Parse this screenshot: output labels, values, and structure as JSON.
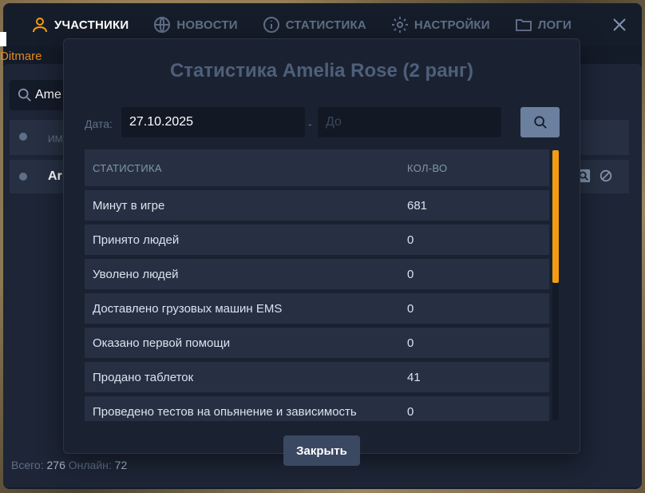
{
  "nav": {
    "tabs": [
      {
        "label": "УЧАСТНИКИ",
        "icon": "user-icon",
        "active": true
      },
      {
        "label": "НОВОСТИ",
        "icon": "globe-icon"
      },
      {
        "label": "СТАТИСТИКА",
        "icon": "info-icon"
      },
      {
        "label": "НАСТРОЙКИ",
        "icon": "gear-icon"
      },
      {
        "label": "ЛОГИ",
        "icon": "folder-icon"
      }
    ]
  },
  "background": {
    "nametag": "Ditmare"
  },
  "members": {
    "search_value": "Ame",
    "header_name": "ИМ",
    "row_name": "Ar",
    "total_label": "Всего:",
    "total_value": "276",
    "online_label": "Онлайн:",
    "online_value": "72"
  },
  "modal": {
    "title": "Статистика Amelia Rose (2 ранг)",
    "date_label": "Дата:",
    "date_from": "27.10.2025",
    "date_separator": "-",
    "date_to_placeholder": "До",
    "columns": [
      "СТАТИСТИКА",
      "КОЛ-ВО"
    ],
    "rows": [
      {
        "name": "Минут в игре",
        "value": "681"
      },
      {
        "name": "Принято людей",
        "value": "0"
      },
      {
        "name": "Уволено людей",
        "value": "0"
      },
      {
        "name": "Доставлено грузовых машин EMS",
        "value": "0"
      },
      {
        "name": "Оказано первой помощи",
        "value": "0"
      },
      {
        "name": "Продано таблеток",
        "value": "41"
      },
      {
        "name": "Проведено тестов на опьянение и зависимость",
        "value": "0"
      }
    ],
    "close_label": "Закрыть"
  },
  "colors": {
    "accent": "#f39c12",
    "panel_bg": "#1a2232",
    "row_bg": "#263042"
  }
}
